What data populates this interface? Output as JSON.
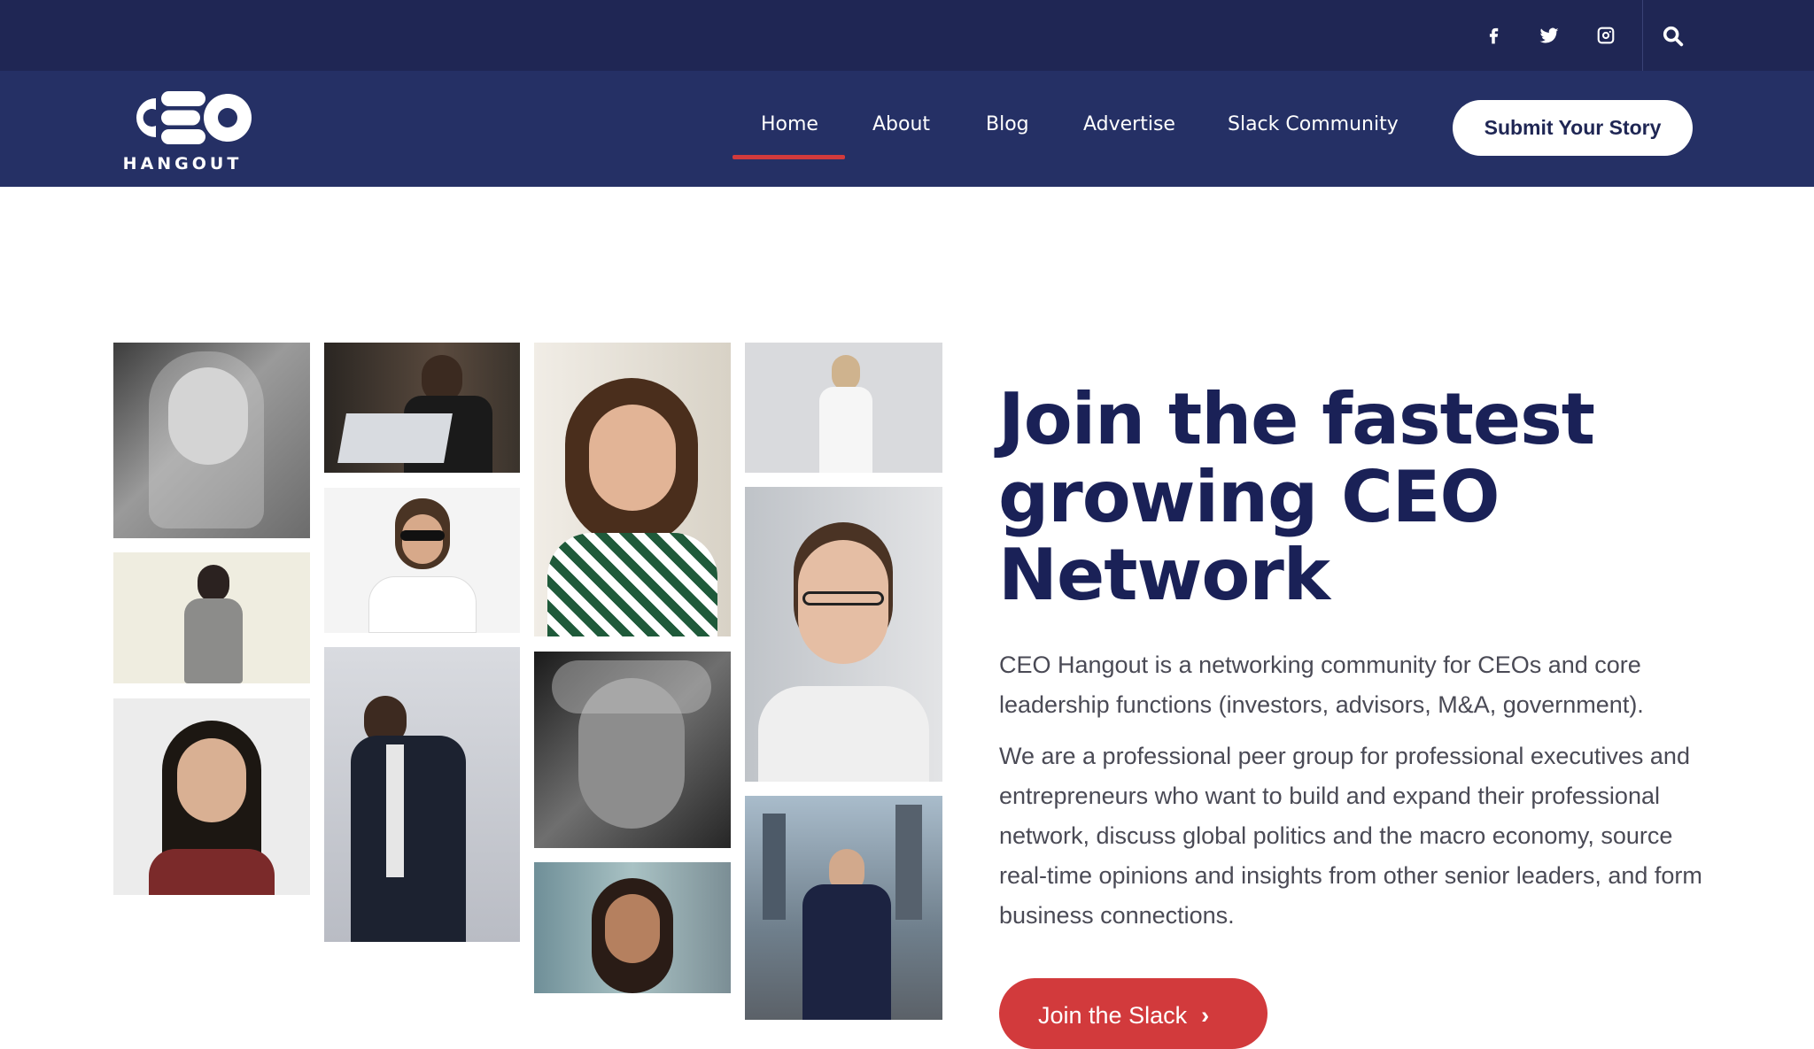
{
  "topbar": {
    "social_icons": [
      "facebook-icon",
      "twitter-icon",
      "instagram-icon"
    ],
    "search_icon": "search-icon"
  },
  "brand": {
    "logo_text": "CEO",
    "logo_subtitle": "HANGOUT"
  },
  "nav": {
    "items": [
      {
        "label": "Home",
        "active": true
      },
      {
        "label": "About",
        "active": false
      },
      {
        "label": "Blog",
        "active": false
      },
      {
        "label": "Advertise",
        "active": false
      },
      {
        "label": "Slack Community",
        "active": false
      }
    ],
    "submit_label": "Submit Your Story"
  },
  "hero": {
    "title_line1": "Join the fastest",
    "title_line2": "growing CEO",
    "title_line3": "Network",
    "paragraph1": "CEO Hangout is a networking community for CEOs and core leadership functions (investors, advisors, M&A, government).",
    "paragraph2": "We are a professional peer group for professional executives and entrepreneurs who want to build and expand their professional network, discuss global politics and the macro economy, source real-time opinions and insights from other senior leaders, and form business connections.",
    "cta_label": "Join the Slack",
    "cta_icon": "chevron-right-icon"
  },
  "colors": {
    "topbar": "#1f2654",
    "navbar": "#253065",
    "accent": "#d23a3c",
    "heading": "#1a2157",
    "body_text": "#4a4a55"
  }
}
